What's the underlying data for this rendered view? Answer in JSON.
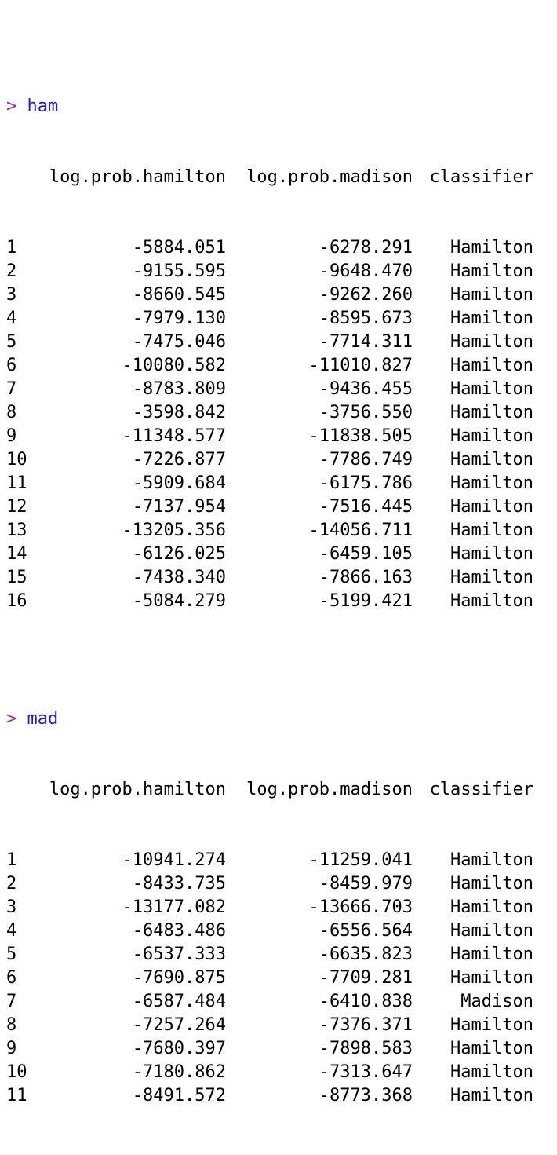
{
  "prompt_symbol": ">",
  "blocks": [
    {
      "command": "ham",
      "headers": [
        "log.prob.hamilton",
        "log.prob.madison",
        "classifier"
      ],
      "rows": [
        [
          "1",
          "-5884.051",
          "-6278.291",
          "Hamilton"
        ],
        [
          "2",
          "-9155.595",
          "-9648.470",
          "Hamilton"
        ],
        [
          "3",
          "-8660.545",
          "-9262.260",
          "Hamilton"
        ],
        [
          "4",
          "-7979.130",
          "-8595.673",
          "Hamilton"
        ],
        [
          "5",
          "-7475.046",
          "-7714.311",
          "Hamilton"
        ],
        [
          "6",
          "-10080.582",
          "-11010.827",
          "Hamilton"
        ],
        [
          "7",
          "-8783.809",
          "-9436.455",
          "Hamilton"
        ],
        [
          "8",
          "-3598.842",
          "-3756.550",
          "Hamilton"
        ],
        [
          "9",
          "-11348.577",
          "-11838.505",
          "Hamilton"
        ],
        [
          "10",
          "-7226.877",
          "-7786.749",
          "Hamilton"
        ],
        [
          "11",
          "-5909.684",
          "-6175.786",
          "Hamilton"
        ],
        [
          "12",
          "-7137.954",
          "-7516.445",
          "Hamilton"
        ],
        [
          "13",
          "-13205.356",
          "-14056.711",
          "Hamilton"
        ],
        [
          "14",
          "-6126.025",
          "-6459.105",
          "Hamilton"
        ],
        [
          "15",
          "-7438.340",
          "-7866.163",
          "Hamilton"
        ],
        [
          "16",
          "-5084.279",
          "-5199.421",
          "Hamilton"
        ]
      ]
    },
    {
      "command": "mad",
      "headers": [
        "log.prob.hamilton",
        "log.prob.madison",
        "classifier"
      ],
      "rows": [
        [
          "1",
          "-10941.274",
          "-11259.041",
          "Hamilton"
        ],
        [
          "2",
          "-8433.735",
          "-8459.979",
          "Hamilton"
        ],
        [
          "3",
          "-13177.082",
          "-13666.703",
          "Hamilton"
        ],
        [
          "4",
          "-6483.486",
          "-6556.564",
          "Hamilton"
        ],
        [
          "5",
          "-6537.333",
          "-6635.823",
          "Hamilton"
        ],
        [
          "6",
          "-7690.875",
          "-7709.281",
          "Hamilton"
        ],
        [
          "7",
          "-6587.484",
          "-6410.838",
          "Madison"
        ],
        [
          "8",
          "-7257.264",
          "-7376.371",
          "Hamilton"
        ],
        [
          "9",
          "-7680.397",
          "-7898.583",
          "Hamilton"
        ],
        [
          "10",
          "-7180.862",
          "-7313.647",
          "Hamilton"
        ],
        [
          "11",
          "-8491.572",
          "-8773.368",
          "Hamilton"
        ]
      ]
    }
  ],
  "colors": {
    "prompt": "#9b2e9b",
    "command": "#1a1ad8",
    "output": "#000000",
    "background": "#ffffff"
  }
}
